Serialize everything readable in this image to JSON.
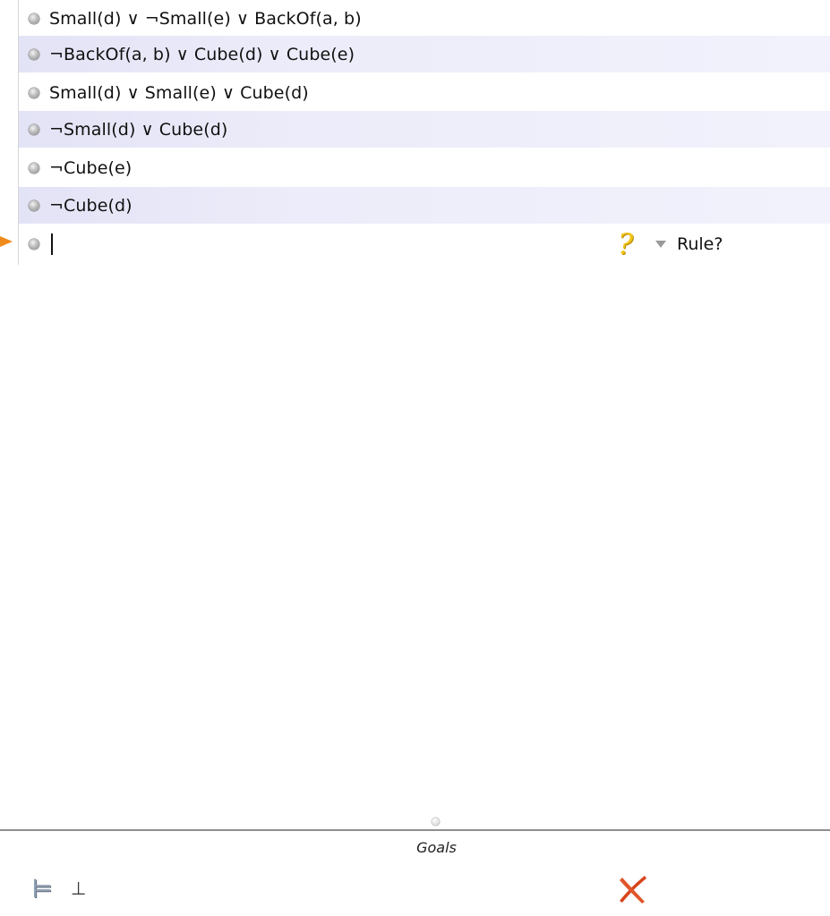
{
  "proof": {
    "lines": [
      {
        "formula": "Small(d) ∨ ¬Small(e) ∨ BackOf(a, b)"
      },
      {
        "formula": "¬BackOf(a, b) ∨ Cube(d) ∨ Cube(e)"
      },
      {
        "formula": "Small(d) ∨ Small(e) ∨ Cube(d)"
      },
      {
        "formula": "¬Small(d) ∨ Cube(d)"
      },
      {
        "formula": "¬Cube(e)"
      },
      {
        "formula": "¬Cube(d)"
      }
    ],
    "current_line": {
      "formula": "",
      "status_icon": "question-mark-icon",
      "rule_label": "Rule?"
    }
  },
  "goals": {
    "title": "Goals",
    "goal": {
      "symbol": "⊥",
      "status_icon": "fail-x-icon"
    }
  },
  "colors": {
    "row_shade": "#e3e3f6",
    "pointer": "#f08a1a",
    "fail_x": "#d8451c",
    "question": "#f2c417"
  }
}
